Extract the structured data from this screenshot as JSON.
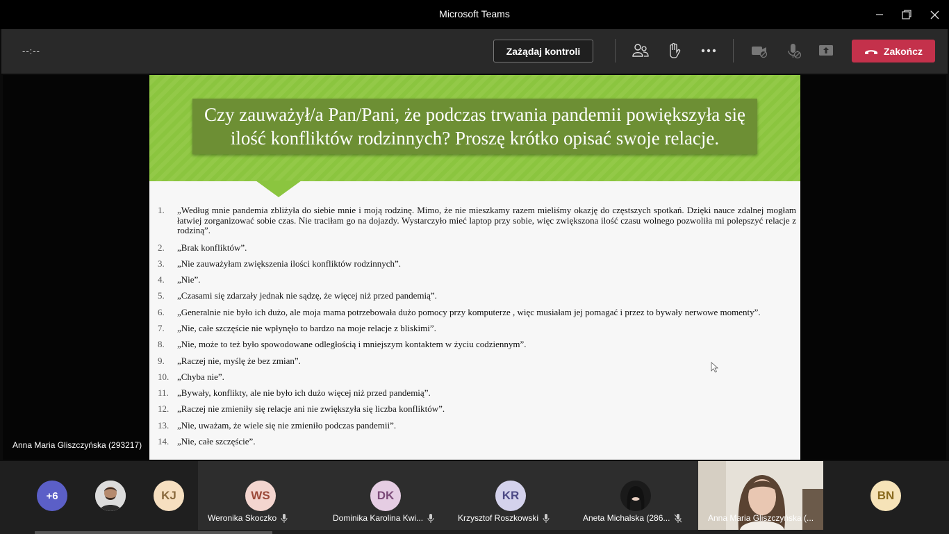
{
  "window": {
    "title": "Microsoft Teams"
  },
  "toolbar": {
    "timer": "--:--",
    "request_control_label": "Zażądaj kontroli",
    "end_label": "Zakończ",
    "icons": [
      "participants-icon",
      "raise-hand-icon",
      "more-icon",
      "camera-off-icon",
      "mic-off-icon",
      "share-icon"
    ]
  },
  "slide": {
    "title": "Czy zauważył/a Pan/Pani, że podczas trwania pandemii powiększyła się ilość konfliktów rodzinnych? Proszę krótko opisać swoje relacje.",
    "answers": [
      {
        "num": "1.",
        "text": "„Według mnie pandemia zbliżyła do siebie mnie i moją rodzinę. Mimo, że nie mieszkamy razem mieliśmy okazję do częstszych spotkań. Dzięki nauce zdalnej mogłam łatwiej zorganizować sobie czas. Nie traciłam go na dojazdy. Wystarczyło mieć laptop przy sobie, więc zwiększona ilość czasu wolnego pozwoliła mi polepszyć relacje z rodziną”."
      },
      {
        "num": "2.",
        "text": "„Brak konfliktów”."
      },
      {
        "num": "3.",
        "text": "„Nie zauważyłam zwiększenia ilości konfliktów rodzinnych”."
      },
      {
        "num": "4.",
        "text": "„Nie”."
      },
      {
        "num": "5.",
        "text": "„Czasami się zdarzały jednak nie sądzę, że więcej niż przed pandemią”."
      },
      {
        "num": "6.",
        "text": "„Generalnie nie było ich dużo, ale moja mama potrzebowała dużo pomocy przy komputerze , więc musiałam jej pomagać i przez to bywały nerwowe momenty”."
      },
      {
        "num": "7.",
        "text": "„Nie, całe szczęście nie wpłynęło to bardzo na moje relacje z bliskimi”."
      },
      {
        "num": "8.",
        "text": "„Nie, może to też było spowodowane odległością i mniejszym kontaktem w życiu codziennym”."
      },
      {
        "num": "9.",
        "text": "„Raczej nie, myślę że bez zmian”."
      },
      {
        "num": "10.",
        "text": "„Chyba nie”."
      },
      {
        "num": "11.",
        "text": "„Bywały, konflikty, ale nie było ich dużo więcej niż przed pandemią”."
      },
      {
        "num": "12.",
        "text": "„Raczej nie zmieniły się relacje ani nie zwiększyła się liczba konfliktów”."
      },
      {
        "num": "13.",
        "text": "„Nie, uważam, że wiele się nie zmieniło podczas pandemii”."
      },
      {
        "num": "14.",
        "text": "„Nie, całe szczęście”."
      }
    ]
  },
  "presenter": {
    "name": "Anna Maria Gliszczyńska (293217)"
  },
  "gallery": {
    "overflow_count": "+6",
    "small_avatars": [
      {
        "initials": "",
        "color": "#e8e8e8"
      },
      {
        "initials": "KJ",
        "color": "#f6dfc0"
      }
    ],
    "tiles": [
      {
        "initials": "WS",
        "name": "Weronika Skoczko",
        "avatar_bg": "#f3d5cf",
        "avatar_fg": "#9c4a3a"
      },
      {
        "initials": "DK",
        "name": "Dominika Karolina Kwi...",
        "avatar_bg": "#e5cde3",
        "avatar_fg": "#7b4a78"
      },
      {
        "initials": "KR",
        "name": "Krzysztof Roszkowski",
        "avatar_bg": "#d4d2ec",
        "avatar_fg": "#4d4a86"
      },
      {
        "initials": "",
        "name": "Aneta Michalska (286...",
        "avatar_bg": "#2a2a2a",
        "avatar_fg": "#fff"
      },
      {
        "initials": "",
        "name": "Anna Maria Gliszczyńska (...",
        "avatar_bg": "#e9e1d6",
        "avatar_fg": "#000"
      }
    ],
    "last_avatar": {
      "initials": "BN",
      "color": "#f6e3b8",
      "fg": "#8a6a1e"
    }
  }
}
